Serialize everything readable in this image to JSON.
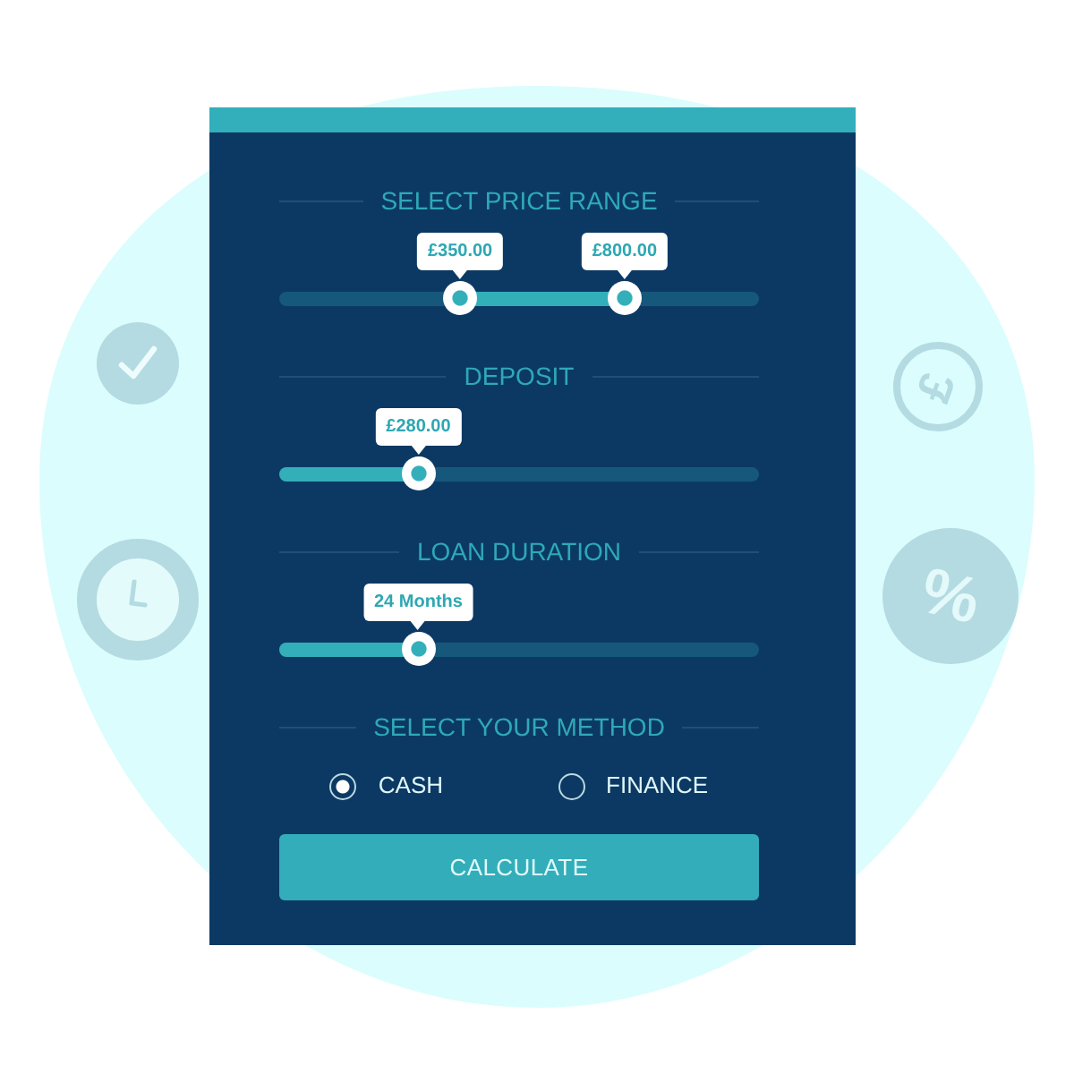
{
  "sections": [
    {
      "kind": "range",
      "title": "SELECT PRICE RANGE",
      "low": {
        "level": 0.377,
        "tooltip": "£350.00"
      },
      "high": {
        "level": 0.72,
        "tooltip": "£800.00"
      }
    },
    {
      "kind": "single",
      "title": "DEPOSIT",
      "level": 0.29,
      "tooltip": "£280.00"
    },
    {
      "kind": "single",
      "title": "LOAN DURATION",
      "level": 0.29,
      "tooltip": "24 Months"
    }
  ],
  "method": {
    "title": "SELECT YOUR METHOD",
    "options": [
      {
        "label": "CASH",
        "selected": true
      },
      {
        "label": "FINANCE",
        "selected": false
      }
    ]
  },
  "button": {
    "label": "CALCULATE"
  },
  "currency_badge": {
    "symbol": "£"
  },
  "percent_badge": {
    "symbol": "%"
  }
}
